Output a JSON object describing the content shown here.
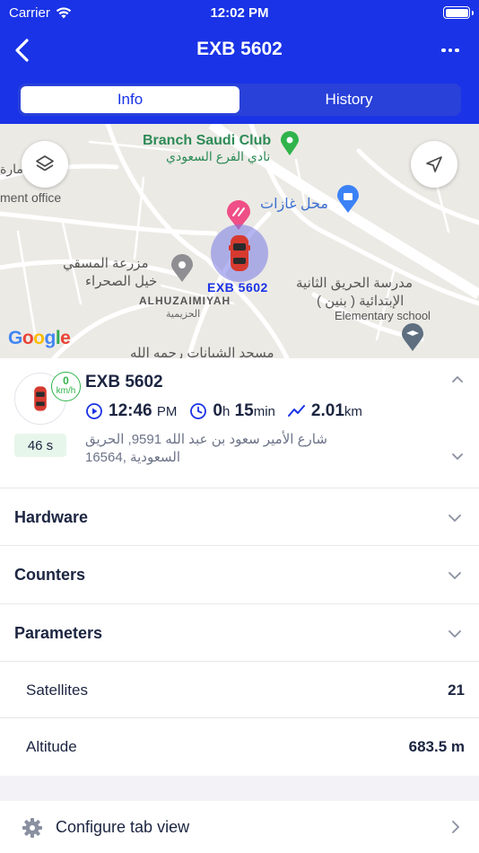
{
  "status_bar": {
    "carrier": "Carrier",
    "time": "12:02 PM"
  },
  "nav": {
    "title": "EXB 5602"
  },
  "tabs": [
    {
      "label": "Info",
      "active": true
    },
    {
      "label": "History",
      "active": false
    }
  ],
  "map": {
    "labels": {
      "branch_club_en": "Branch Saudi Club",
      "branch_club_ar": "نادي الفرع السعودي",
      "imara": "امارة",
      "management_office": "ment office",
      "mahal_gharat": "محل غازات",
      "farm_ar_1": "مزرعة المسقي",
      "farm_ar_2": "خيل الصحراء",
      "alhuzaimiyah_en": "ALHUZAIMIYAH",
      "alhuzaimiyah_ar": "الحزيمية",
      "school_ar_1": "مدرسة الحريق الثانية",
      "school_ar_2": "الإبتدائية ( بنين )",
      "school_en": "Elementary school",
      "mosque_ar": "مسجد الشبانات رحمه الله",
      "car_label": "EXB 5602",
      "google": "Google"
    },
    "colors": {
      "halo": "#7878e6",
      "pin": "#ef4f86",
      "marker_green": "#2fb34a"
    }
  },
  "unit": {
    "name": "EXB 5602",
    "speed_value": "0",
    "speed_unit": "km/h",
    "age": "46 s",
    "time_value": "12:46",
    "time_suffix": "PM",
    "duration_h": "0",
    "duration_h_unit": "h",
    "duration_min": "15",
    "duration_min_unit": "min",
    "distance_value": "2.01",
    "distance_unit": "km",
    "address_line1": "شارع الأمير سعود بن عبد الله 9591, الحريق",
    "address_line2": "16564, السعودية"
  },
  "sections": [
    {
      "title": "Hardware"
    },
    {
      "title": "Counters"
    },
    {
      "title": "Parameters"
    }
  ],
  "parameters": [
    {
      "label": "Satellites",
      "value": "21"
    },
    {
      "label": "Altitude",
      "value": "683.5 m"
    }
  ],
  "config": {
    "label": "Configure tab view"
  },
  "icons": {
    "wifi": "wifi-icon",
    "back": "chevron-left-icon",
    "more": "more-horizontal-icon",
    "layers": "layers-icon",
    "locate": "navigation-arrow-icon",
    "gear": "gear-icon"
  }
}
